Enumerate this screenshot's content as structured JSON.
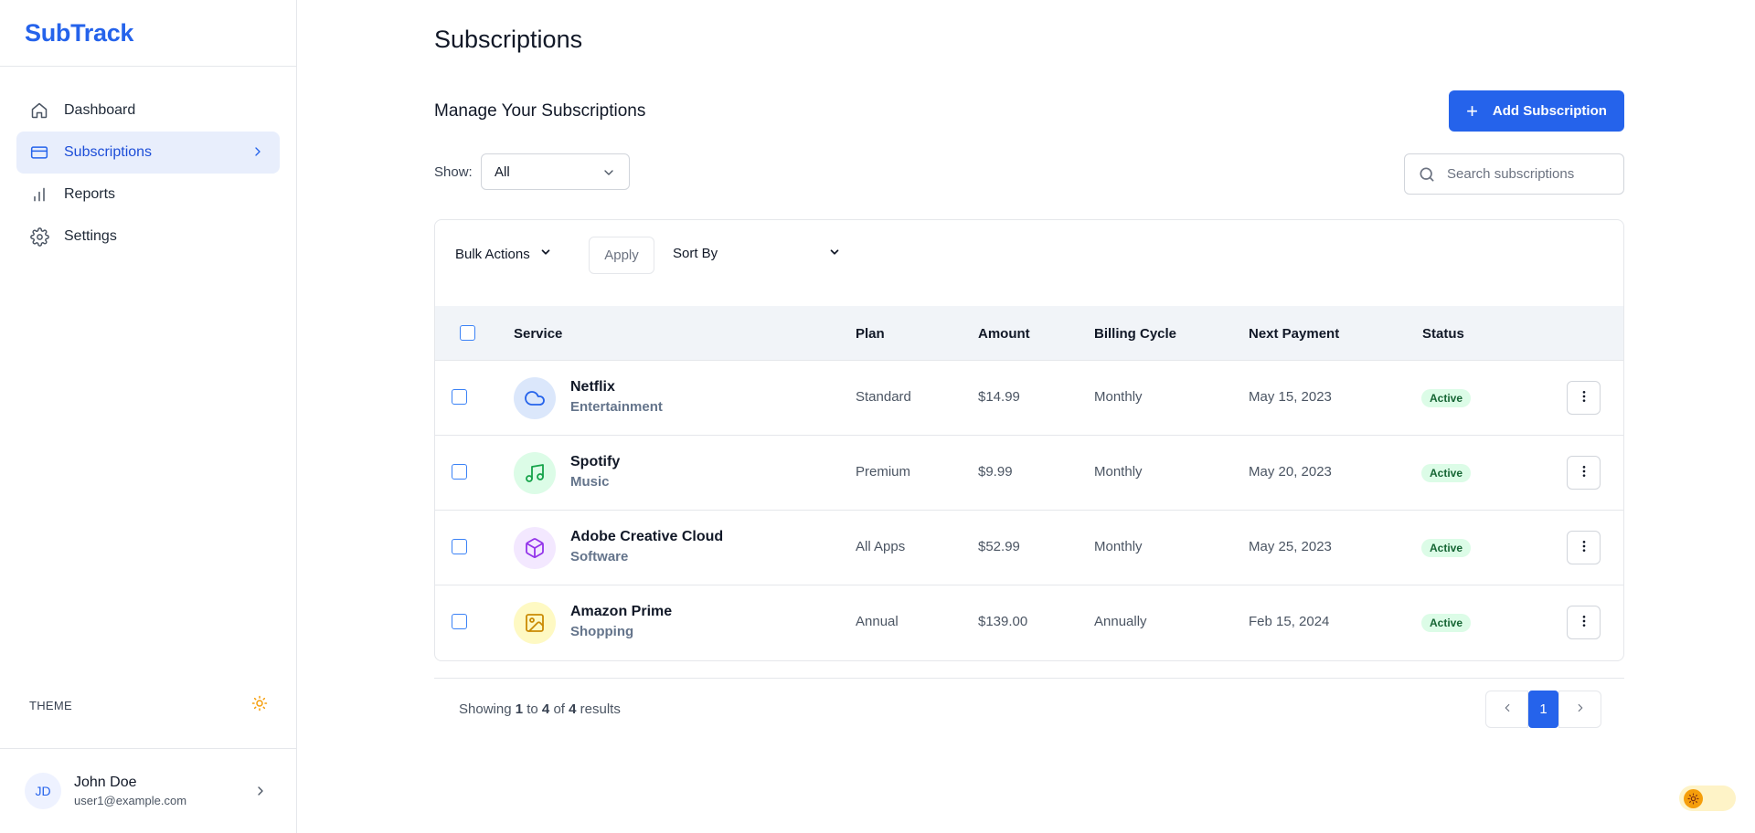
{
  "brand": {
    "name": "SubTrack",
    "color": "#2563eb"
  },
  "sidebar": {
    "items": [
      {
        "label": "Dashboard",
        "icon": "home-icon",
        "active": false
      },
      {
        "label": "Subscriptions",
        "icon": "credit-card-icon",
        "active": true
      },
      {
        "label": "Reports",
        "icon": "bar-chart-icon",
        "active": false
      },
      {
        "label": "Settings",
        "icon": "gear-icon",
        "active": false
      }
    ],
    "theme_label": "THEME",
    "user": {
      "initials": "JD",
      "name": "John Doe",
      "email": "user1@example.com"
    }
  },
  "main": {
    "page_title": "Subscriptions",
    "section_title": "Manage Your Subscriptions",
    "add_button": "Add Subscription",
    "show_label": "Show:",
    "show_value": "All",
    "search_placeholder": "Search subscriptions",
    "bulk_actions": "Bulk Actions",
    "apply": "Apply",
    "sort_by": "Sort By",
    "columns": {
      "service": "Service",
      "plan": "Plan",
      "amount": "Amount",
      "billing_cycle": "Billing Cycle",
      "next_payment": "Next Payment",
      "status": "Status"
    },
    "rows": [
      {
        "name": "Netflix",
        "category": "Entertainment",
        "plan": "Standard",
        "amount": "$14.99",
        "cycle": "Monthly",
        "next": "May 15, 2023",
        "status": "Active",
        "icon": "cloud-icon",
        "icon_color": "#2563eb",
        "icon_bg": "#dbe7fb"
      },
      {
        "name": "Spotify",
        "category": "Music",
        "plan": "Premium",
        "amount": "$9.99",
        "cycle": "Monthly",
        "next": "May 20, 2023",
        "status": "Active",
        "icon": "music-icon",
        "icon_color": "#16a34a",
        "icon_bg": "#dcfce7"
      },
      {
        "name": "Adobe Creative Cloud",
        "category": "Software",
        "plan": "All Apps",
        "amount": "$52.99",
        "cycle": "Monthly",
        "next": "May 25, 2023",
        "status": "Active",
        "icon": "cube-icon",
        "icon_color": "#9333ea",
        "icon_bg": "#f3e8ff"
      },
      {
        "name": "Amazon Prime",
        "category": "Shopping",
        "plan": "Annual",
        "amount": "$139.00",
        "cycle": "Annually",
        "next": "Feb 15, 2024",
        "status": "Active",
        "icon": "image-icon",
        "icon_color": "#ca8a04",
        "icon_bg": "#fef9c3"
      }
    ],
    "pagination": {
      "showing_prefix": "Showing",
      "from": "1",
      "to_word": "to",
      "to": "4",
      "of_word": "of",
      "total": "4",
      "results_word": "results",
      "current_page": "1"
    }
  }
}
